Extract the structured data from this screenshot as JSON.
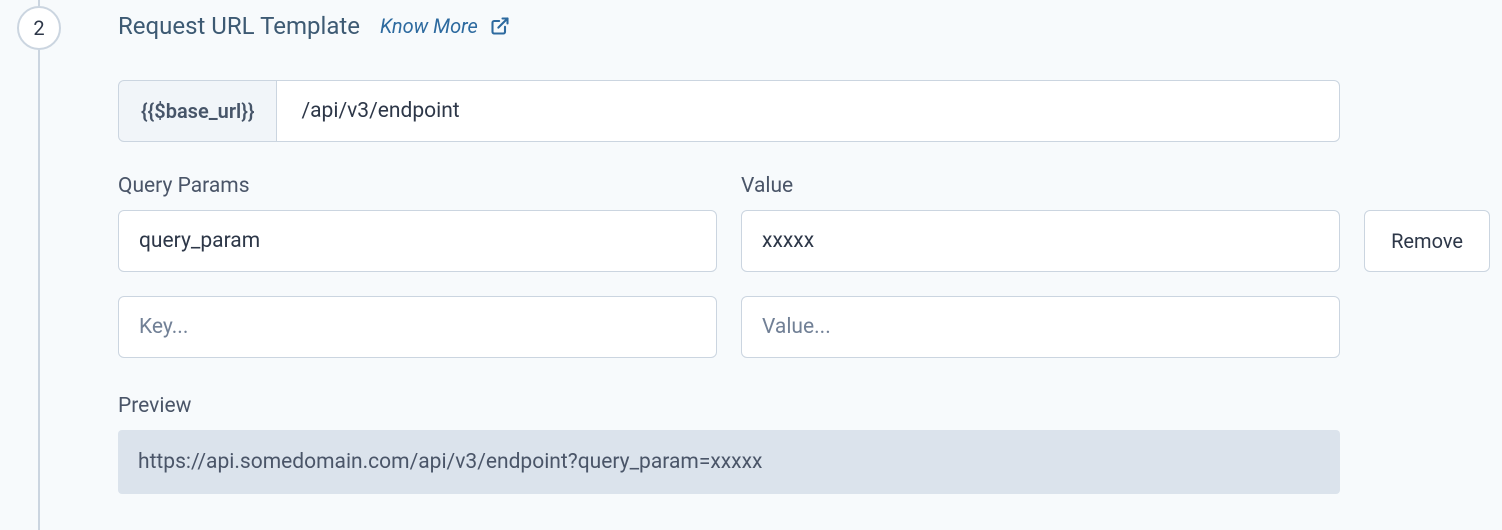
{
  "step": {
    "number": "2",
    "title": "Request URL Template",
    "know_more_label": "Know More"
  },
  "url": {
    "base_prefix": "{{$base_url}}",
    "path_value": "/api/v3/endpoint"
  },
  "params": {
    "key_label": "Query Params",
    "value_label": "Value",
    "rows": [
      {
        "key": "query_param",
        "value": "xxxxx"
      }
    ],
    "placeholder_key": "Key...",
    "placeholder_value": "Value...",
    "remove_label": "Remove"
  },
  "preview": {
    "label": "Preview",
    "text": "https://api.somedomain.com/api/v3/endpoint?query_param=xxxxx"
  }
}
